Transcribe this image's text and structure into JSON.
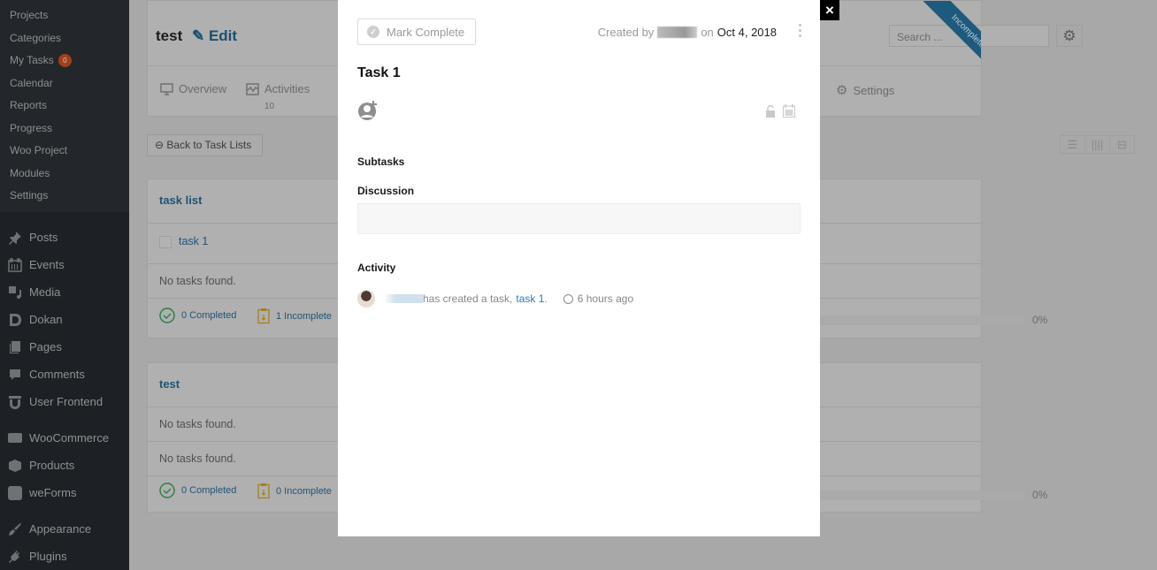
{
  "sidebar": {
    "submenu": [
      {
        "label": "Projects"
      },
      {
        "label": "Categories"
      },
      {
        "label": "My Tasks",
        "badge": "0"
      },
      {
        "label": "Calendar"
      },
      {
        "label": "Reports"
      },
      {
        "label": "Progress"
      },
      {
        "label": "Woo Project"
      },
      {
        "label": "Modules"
      },
      {
        "label": "Settings"
      }
    ],
    "menu": [
      {
        "label": "Posts",
        "icon": "pin-icon"
      },
      {
        "label": "Events",
        "icon": "calendar-icon"
      },
      {
        "label": "Media",
        "icon": "media-icon"
      },
      {
        "label": "Dokan",
        "icon": "dokan-icon"
      },
      {
        "label": "Pages",
        "icon": "pages-icon"
      },
      {
        "label": "Comments",
        "icon": "comment-icon"
      },
      {
        "label": "User Frontend",
        "icon": "user-frontend-icon"
      },
      {
        "label": "WooCommerce",
        "icon": "woo-icon"
      },
      {
        "label": "Products",
        "icon": "box-icon"
      },
      {
        "label": "weForms",
        "icon": "weforms-icon"
      },
      {
        "label": "Appearance",
        "icon": "brush-icon"
      },
      {
        "label": "Plugins",
        "icon": "plug-icon"
      }
    ]
  },
  "project": {
    "title": "test",
    "edit_label": "Edit",
    "tabs": [
      {
        "label": "Overview"
      },
      {
        "label": "Activities",
        "count": "10"
      },
      {
        "label": "Settings"
      }
    ],
    "search_placeholder": "Search ...",
    "status_ribbon": "Incomplete",
    "back_label": "Back to Task Lists"
  },
  "task_lists": [
    {
      "title": "task list",
      "tasks": [
        {
          "title": "task 1",
          "completed": false
        }
      ],
      "empty_text": "No tasks found.",
      "completed_label": "0 Completed",
      "incomplete_label": "1 Incomplete",
      "progress_percent": 0,
      "progress_label": "0%"
    },
    {
      "title": "test",
      "empty_text_1": "No tasks found.",
      "empty_text_2": "No tasks found.",
      "completed_label": "0 Completed",
      "incomplete_label": "0 Incomplete",
      "progress_percent": 0,
      "progress_label": "0%"
    }
  ],
  "modal": {
    "mark_complete_label": "Mark Complete",
    "created_by_prefix": "Created by",
    "created_on": "on",
    "created_date": "Oct 4, 2018",
    "task_title": "Task 1",
    "subtasks_label": "Subtasks",
    "discussion_label": "Discussion",
    "activity_label": "Activity",
    "activity_text": "has created a task,",
    "activity_link": "task 1",
    "activity_suffix": ".",
    "activity_time": "6 hours ago",
    "close_label": "×"
  }
}
